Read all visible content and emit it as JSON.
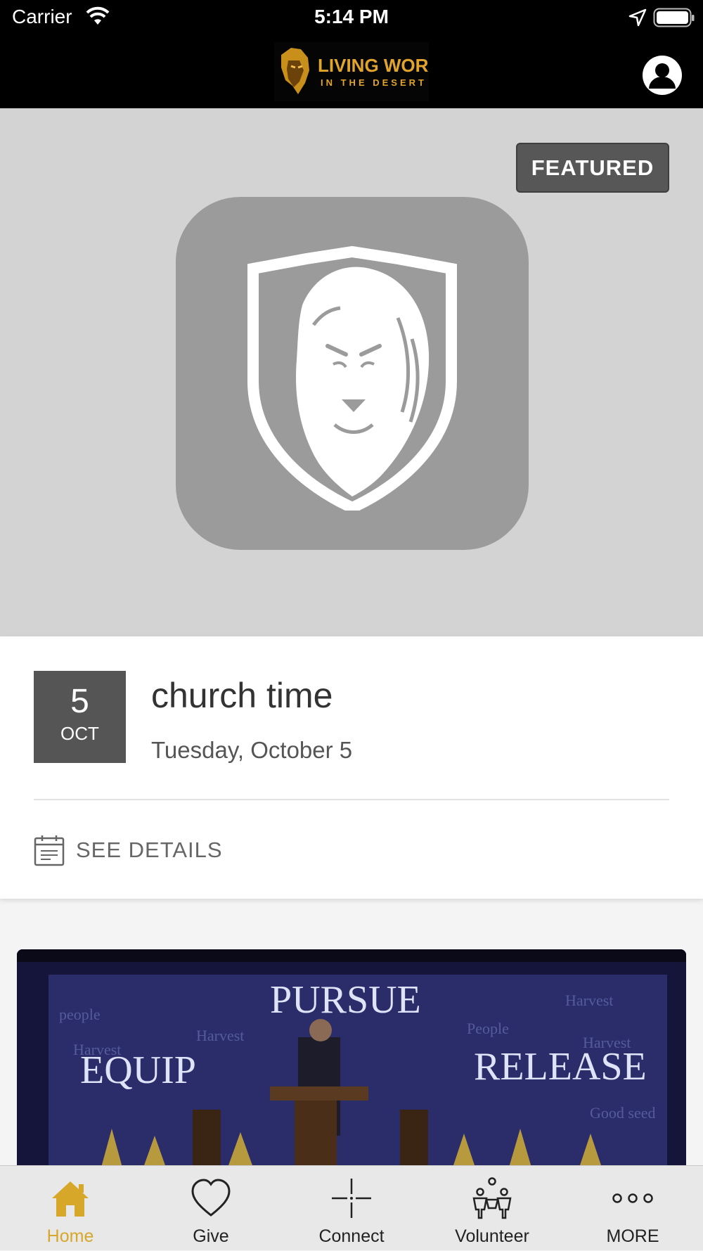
{
  "status_bar": {
    "carrier": "Carrier",
    "time": "5:14 PM"
  },
  "nav": {
    "logo_line1": "LIVING WORD",
    "logo_line2": "IN THE DESERT"
  },
  "featured": {
    "badge": "FEATURED"
  },
  "event": {
    "day": "5",
    "month": "OCT",
    "title": "church time",
    "date_text": "Tuesday, October 5",
    "details_label": "SEE DETAILS"
  },
  "video": {
    "banner_top": "PURSUE",
    "banner_left": "EQUIP",
    "banner_right": "RELEASE"
  },
  "tabs": [
    {
      "label": "Home",
      "icon": "home-icon",
      "active": true
    },
    {
      "label": "Give",
      "icon": "heart-icon",
      "active": false
    },
    {
      "label": "Connect",
      "icon": "crosshair-icon",
      "active": false
    },
    {
      "label": "Volunteer",
      "icon": "people-icon",
      "active": false
    },
    {
      "label": "MORE",
      "icon": "more-icon",
      "active": false
    }
  ],
  "colors": {
    "accent": "#d7a72a",
    "hero_bg": "#d3d3d3",
    "badge_bg": "#575757",
    "date_box_bg": "#555555"
  }
}
